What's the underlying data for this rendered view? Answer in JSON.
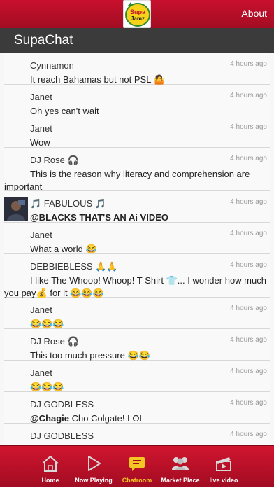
{
  "header": {
    "about_label": "About",
    "logo_text": "Supa Jamz"
  },
  "title": "SupaChat",
  "messages": [
    {
      "name": "Cynnamon",
      "time": "4 hours ago",
      "text": "It reach Bahamas but not PSL 🤷"
    },
    {
      "name": "Janet",
      "time": "4 hours ago",
      "text": "Oh yes can't wait"
    },
    {
      "name": "Janet",
      "time": "4 hours ago",
      "text": "Wow"
    },
    {
      "name": "DJ Rose 🎧",
      "time": "4 hours ago",
      "text": "This is the reason why literacy and comprehension are important"
    },
    {
      "name": "🎵 FABULOUS 🎵",
      "time": "4 hours ago",
      "text": "@BLACKS THAT'S AN Ai VIDEO"
    },
    {
      "name": "Janet",
      "time": "4 hours ago",
      "text": "What a world 😂"
    },
    {
      "name": "DEBBIEBLESS 🙏🙏",
      "time": "4 hours ago",
      "text": "I like The Whoop! Whoop! T-Shirt 👕... I wonder how much you pay💰 for it 😂😂😂"
    },
    {
      "name": "Janet",
      "time": "4 hours ago",
      "text": "😂😂😂"
    },
    {
      "name": "DJ Rose 🎧",
      "time": "4 hours ago",
      "text": "This too much pressure 😂😂"
    },
    {
      "name": "Janet",
      "time": "4 hours ago",
      "text": "😂😂😂"
    },
    {
      "name": "DJ GODBLESS",
      "time": "4 hours ago",
      "mention": "@Chagie",
      "text": " Cho Colgate! LOL"
    },
    {
      "name": "DJ GODBLESS",
      "time": "4 hours ago",
      "text": ""
    }
  ],
  "nav": {
    "home": "Home",
    "now_playing": "Now Playing",
    "chatroom": "Chatroom",
    "market_place": "Market Place",
    "live_video": "live video"
  },
  "colors": {
    "brand_red": "#c8102e",
    "title_bar": "#3b3b3b",
    "active_nav": "#f3c623"
  }
}
